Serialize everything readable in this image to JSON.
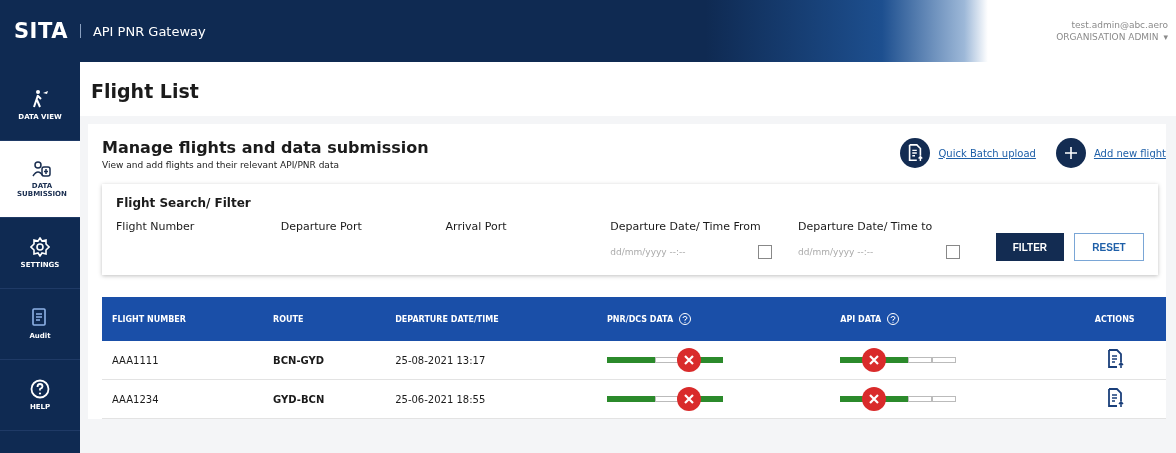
{
  "header": {
    "logo": "SITA",
    "app_name": "API PNR Gateway",
    "user_email": "test.admin@abc.aero",
    "user_role": "ORGANISATION ADMIN",
    "menu_caret": "▾"
  },
  "sidebar": {
    "items": [
      {
        "label": "DATA VIEW",
        "selected": false
      },
      {
        "label": "DATA SUBMISSION",
        "selected": true
      },
      {
        "label": "SETTINGS",
        "selected": false
      },
      {
        "label": "Audit",
        "selected": false
      },
      {
        "label": "HELP",
        "selected": false
      }
    ]
  },
  "page_title": "Flight List",
  "section": {
    "title": "Manage flights and data submission",
    "subtitle": "View and add flights and their relevant API/PNR data",
    "actions": [
      {
        "kind": "upload",
        "label": "Quick Batch upload"
      },
      {
        "kind": "add",
        "label": "Add new flight"
      }
    ]
  },
  "filter": {
    "title": "Flight Search/ Filter",
    "fields": [
      {
        "kind": "text",
        "label": "Flight Number"
      },
      {
        "kind": "text",
        "label": "Departure Port"
      },
      {
        "kind": "text",
        "label": "Arrival Port"
      },
      {
        "kind": "date",
        "label": "Departure Date/ Time From",
        "placeholder": "dd/mm/yyyy --:--"
      },
      {
        "kind": "date",
        "label": "Departure Date/ Time to",
        "placeholder": "dd/mm/yyyy --:--"
      }
    ],
    "buttons": [
      {
        "kind": "primary",
        "label": "FILTER"
      },
      {
        "kind": "secondary",
        "label": "RESET"
      }
    ]
  },
  "table": {
    "columns": [
      {
        "label": "FLIGHT NUMBER",
        "help": false
      },
      {
        "label": "ROUTE",
        "help": false
      },
      {
        "label": "DEPARTURE DATE/TIME",
        "help": false
      },
      {
        "label": "PNR/DCS DATA",
        "help": true
      },
      {
        "label": "API DATA",
        "help": true
      },
      {
        "label": "ACTIONS",
        "help": false
      }
    ],
    "rows": [
      {
        "flight_number": "AAA1111",
        "route": "BCN-GYD",
        "departure": "25-08-2021 13:17",
        "pnr_dcs": [
          {
            "kind": "done"
          },
          {
            "kind": "done"
          },
          {
            "kind": "pending"
          },
          {
            "kind": "failed"
          },
          {
            "kind": "done"
          }
        ],
        "api": [
          {
            "kind": "done"
          },
          {
            "kind": "failed"
          },
          {
            "kind": "done"
          },
          {
            "kind": "pending"
          },
          {
            "kind": "pending"
          }
        ]
      },
      {
        "flight_number": "AAA1234",
        "route": "GYD-BCN",
        "departure": "25-06-2021 18:55",
        "pnr_dcs": [
          {
            "kind": "done"
          },
          {
            "kind": "done"
          },
          {
            "kind": "pending"
          },
          {
            "kind": "failed"
          },
          {
            "kind": "done"
          }
        ],
        "api": [
          {
            "kind": "done"
          },
          {
            "kind": "failed"
          },
          {
            "kind": "done"
          },
          {
            "kind": "pending"
          },
          {
            "kind": "pending"
          }
        ]
      }
    ]
  }
}
